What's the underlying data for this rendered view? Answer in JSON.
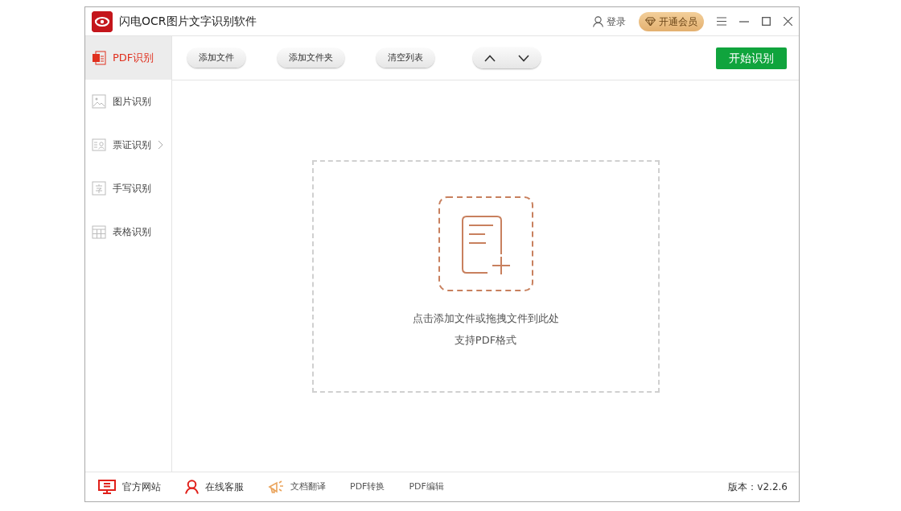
{
  "window": {
    "title": "闪电OCR图片文字识别软件"
  },
  "header": {
    "login": "登录",
    "vip": "开通会员"
  },
  "sidebar": {
    "items": [
      {
        "label": "PDF识别",
        "kind": "pdf",
        "selected": true,
        "has_submenu": false
      },
      {
        "label": "图片识别",
        "kind": "image",
        "selected": false,
        "has_submenu": false
      },
      {
        "label": "票证识别",
        "kind": "card",
        "selected": false,
        "has_submenu": true
      },
      {
        "label": "手写识别",
        "kind": "handwriting",
        "selected": false,
        "has_submenu": false
      },
      {
        "label": "表格识别",
        "kind": "table",
        "selected": false,
        "has_submenu": false
      }
    ]
  },
  "toolbar": {
    "buttons": [
      "添加文件",
      "添加文件夹",
      "清空列表"
    ],
    "start": "开始识别"
  },
  "drop_zone": {
    "line_1": "点击添加文件或拖拽文件到此处",
    "line_2": "支持PDF格式"
  },
  "status_bar": {
    "links": [
      {
        "label": "官方网站",
        "kind": "website"
      },
      {
        "label": "在线客服",
        "kind": "service"
      },
      {
        "label": "文档翻译",
        "kind": "translate"
      },
      {
        "label": "PDF转换",
        "kind": "plain"
      },
      {
        "label": "PDF编辑",
        "kind": "plain"
      }
    ],
    "version": "版本：v2.2.6"
  }
}
